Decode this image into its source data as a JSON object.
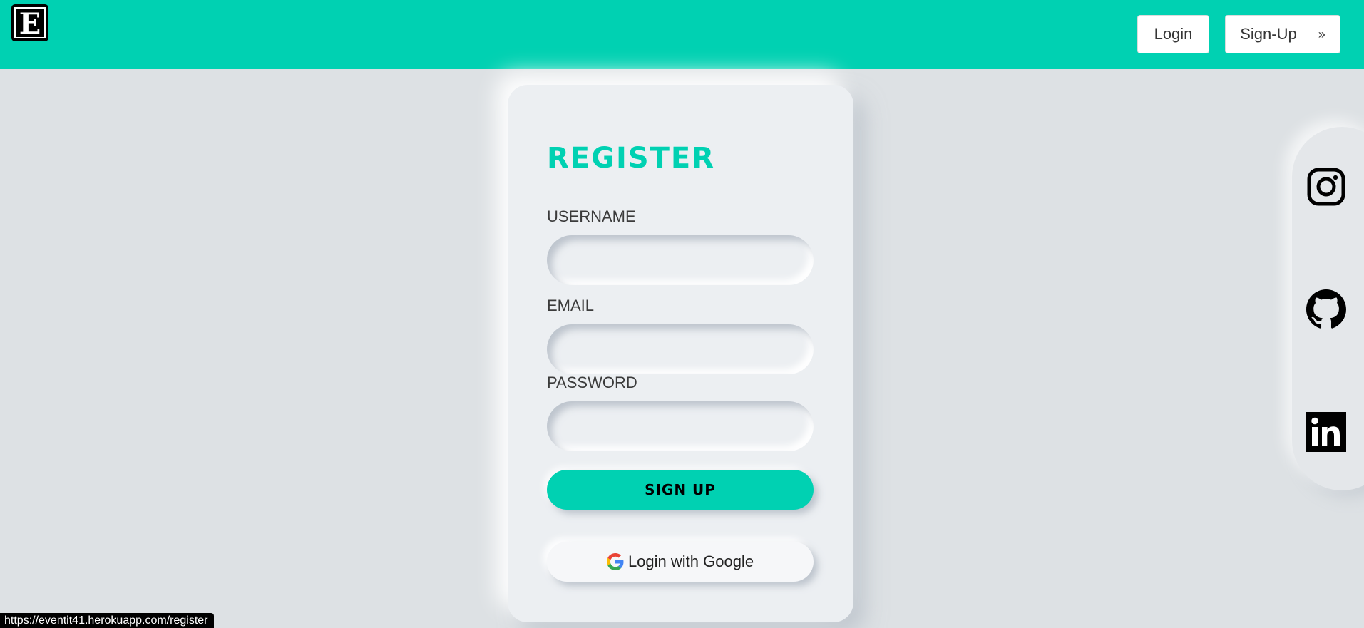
{
  "header": {
    "logo_letter": "E",
    "login_label": "Login",
    "signup_label": "Sign-Up",
    "signup_chevron": "»",
    "background_color": "#00d1b2"
  },
  "register": {
    "title": "REGISTER",
    "username_label": "USERNAME",
    "username_value": "",
    "email_label": "EMAIL",
    "email_value": "",
    "password_label": "PASSWORD",
    "password_value": "",
    "signup_button": "SIGN UP",
    "google_button": "Login with Google",
    "accent_color": "#00d1b2"
  },
  "social": {
    "icons": [
      "instagram-icon",
      "github-icon",
      "linkedin-icon"
    ]
  },
  "status_bar": {
    "url": "https://eventit41.herokuapp.com/register"
  }
}
